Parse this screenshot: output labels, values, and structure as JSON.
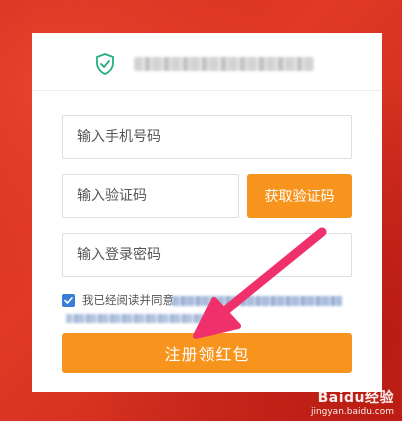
{
  "form": {
    "phone_placeholder": "输入手机号码",
    "code_placeholder": "输入验证码",
    "password_placeholder": "输入登录密码",
    "get_code_label": "获取验证码",
    "agree_text": "我已经阅读并同意",
    "agree_checked": true,
    "register_label": "注册领红包"
  },
  "watermark": {
    "logo": "Baidu经验",
    "url": "jingyan.baidu.com"
  },
  "colors": {
    "background": "#d42d1f",
    "accent": "#f7941d",
    "checkbox": "#3a7dd8",
    "arrow": "#f0306a",
    "shield": "#23b07d"
  },
  "icons": [
    "shield-check-icon",
    "checkbox-check-icon",
    "pointer-arrow"
  ]
}
